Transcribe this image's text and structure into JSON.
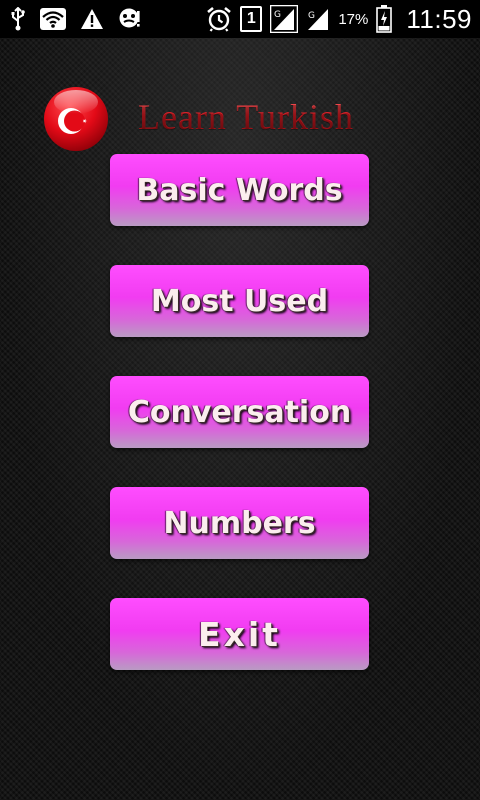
{
  "status_bar": {
    "icons": [
      "usb-icon",
      "wifi-icon",
      "warning-icon",
      "debug-icon",
      "alarm-icon",
      "sim-icon",
      "signal-icon",
      "signal-icon-2",
      "battery-icon"
    ],
    "sim_number": "1",
    "battery_percent": "17%",
    "clock": "11:59"
  },
  "header": {
    "title": "Learn Turkish",
    "flag_icon": "turkey-flag-icon"
  },
  "menu": {
    "items": [
      {
        "label": "Basic Words"
      },
      {
        "label": "Most Used"
      },
      {
        "label": "Conversation"
      },
      {
        "label": "Numbers"
      },
      {
        "label": "Exit"
      }
    ]
  },
  "colors": {
    "button_top": "#ff4dff",
    "button_bottom": "#b99bc3",
    "title_red": "#d8272f",
    "flag_red": "#e30a17"
  }
}
